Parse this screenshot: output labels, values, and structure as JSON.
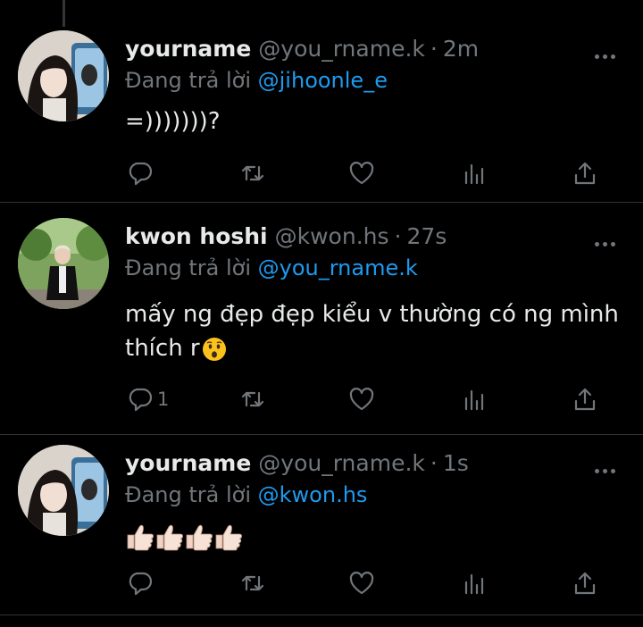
{
  "tweets": [
    {
      "name": "yourname",
      "handle": "@you_rname.k",
      "time": "2m",
      "replying_prefix": "Đang trả lời ",
      "replying_to": "@jihoonle_e",
      "text": "=)))))))?",
      "reply_count": ""
    },
    {
      "name": "kwon hoshi",
      "handle": "@kwon.hs",
      "time": "27s",
      "replying_prefix": "Đang trả lời ",
      "replying_to": "@you_rname.k",
      "text_line1": "mấy ng đẹp đẹp kiểu v thường có ng mình",
      "text_line2": "thích r",
      "reply_count": "1"
    },
    {
      "name": "yourname",
      "handle": "@you_rname.k",
      "time": "1s",
      "replying_prefix": "Đang trả lời ",
      "replying_to": "@kwon.hs",
      "reply_count": ""
    }
  ],
  "separator": "·",
  "icons": [
    "reply-icon",
    "retweet-icon",
    "like-icon",
    "analytics-icon",
    "share-icon",
    "more-icon",
    "hushed-face-emoji",
    "thumbs-up-emoji"
  ],
  "colors": {
    "background": "#000000",
    "text": "#e7e9ea",
    "muted": "#71767b",
    "link": "#1d9bf0",
    "divider": "#2f3336"
  }
}
